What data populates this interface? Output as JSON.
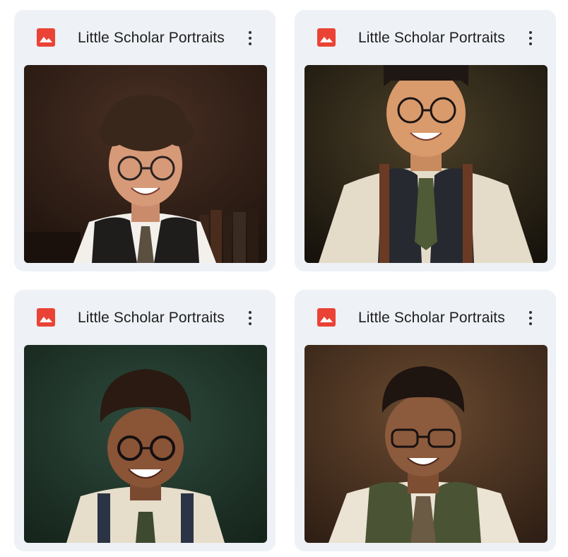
{
  "files": [
    {
      "title": "Little Scholar Portraits",
      "icon": "image-file-icon",
      "icon_color": "#ea4335",
      "menu_icon": "more-vert-icon",
      "thumbnail_description": "boy-curly-hair-glasses-vest-bookshelf",
      "colors": {
        "bg": "#2c1c14",
        "skin": "#d69a78",
        "hair": "#3a271c",
        "shirt": "#f3f0ec",
        "vest": "#1f1d1c",
        "tie": "#5b5040"
      }
    },
    {
      "title": "Little Scholar Portraits",
      "icon": "image-file-icon",
      "icon_color": "#ea4335",
      "menu_icon": "more-vert-icon",
      "thumbnail_description": "boy-glasses-suspenders-green-tie",
      "colors": {
        "bg": "#2b2416",
        "skin": "#d99a6c",
        "hair": "#1f1713",
        "shirt": "#e4dcc9",
        "vest": "#262a30",
        "tie": "#4f5a36"
      }
    },
    {
      "title": "Little Scholar Portraits",
      "icon": "image-file-icon",
      "icon_color": "#ea4335",
      "menu_icon": "more-vert-icon",
      "thumbnail_description": "boy-afro-glasses-suspenders-green-backdrop",
      "colors": {
        "bg": "#1d3229",
        "skin": "#8a5436",
        "hair": "#2a1a12",
        "shirt": "#e6ddcb",
        "vest": "#2a3445",
        "tie": "#3e4a30"
      }
    },
    {
      "title": "Little Scholar Portraits",
      "icon": "image-file-icon",
      "icon_color": "#ea4335",
      "menu_icon": "more-vert-icon",
      "thumbnail_description": "boy-glasses-green-sweater-vest-brown-backdrop",
      "colors": {
        "bg": "#4a3322",
        "skin": "#8c5a3c",
        "hair": "#1e1410",
        "shirt": "#ebe3d3",
        "vest": "#4a5434",
        "tie": "#6b5a44"
      }
    }
  ]
}
